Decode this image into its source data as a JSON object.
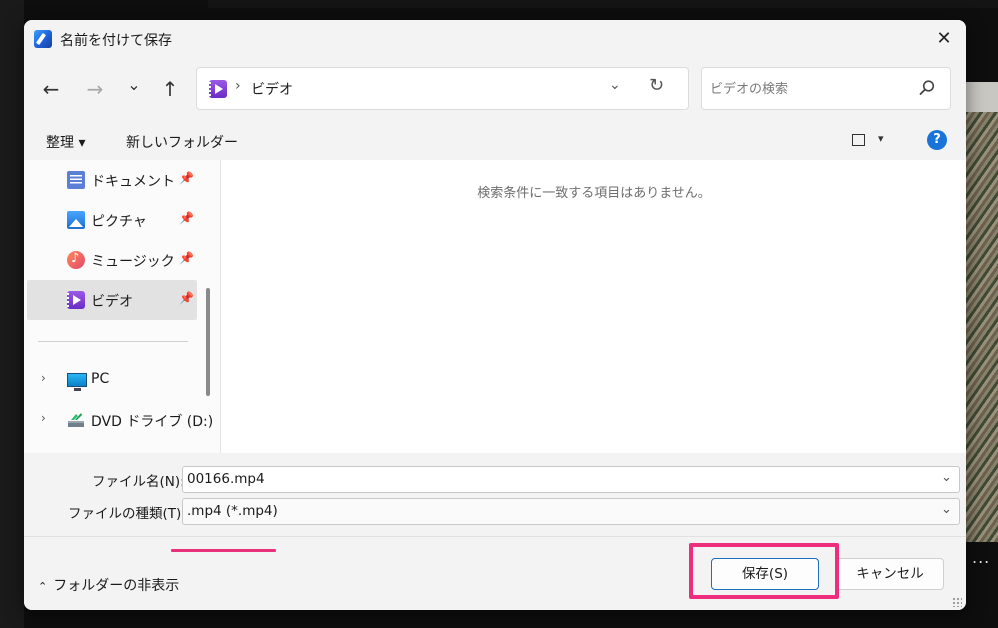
{
  "window": {
    "title": "名前を付けて保存",
    "close_glyph": "✕"
  },
  "nav": {
    "back_glyph": "←",
    "forward_glyph": "→",
    "recent_glyph": "⌄",
    "up_glyph": "↑",
    "address_separator": "›",
    "address_location": "ビデオ",
    "address_dropdown_glyph": "⌄",
    "refresh_glyph": "↻",
    "search_placeholder": "ビデオの検索"
  },
  "toolbar": {
    "organize_label": "整理 ▾",
    "new_folder_label": "新しいフォルダー",
    "view_arrow_glyph": "▾",
    "help_glyph": "?"
  },
  "sidebar": {
    "pin_glyph": "📌",
    "expander_glyph": "›",
    "items": [
      {
        "label": "ドキュメント",
        "icon": "document-icon",
        "pinned": true
      },
      {
        "label": "ピクチャ",
        "icon": "pictures-icon",
        "pinned": true
      },
      {
        "label": "ミュージック",
        "icon": "music-icon",
        "pinned": true
      },
      {
        "label": "ビデオ",
        "icon": "videos-icon",
        "pinned": true,
        "selected": true
      },
      {
        "label": "PC",
        "icon": "pc-icon",
        "expandable": true
      },
      {
        "label": "DVD ドライブ (D:)",
        "icon": "dvd-drive-icon",
        "expandable": true
      }
    ]
  },
  "file_list": {
    "empty_message": "検索条件に一致する項目はありません。"
  },
  "form": {
    "filename_label": "ファイル名(N):",
    "filename_value": "00166.mp4",
    "filetype_label": "ファイルの種類(T):",
    "filetype_value": ".mp4 (*.mp4)",
    "dropdown_glyph": "⌄"
  },
  "footer": {
    "hide_folders_chevron": "⌃",
    "hide_folders_label": "フォルダーの非表示",
    "save_label": "保存(S)",
    "cancel_label": "キャンセル"
  },
  "background": {
    "more_glyph": "..."
  },
  "colors": {
    "accent": "#1a73d9",
    "highlight": "#ee2d7c",
    "dialog_bg": "#f3f3f3"
  }
}
